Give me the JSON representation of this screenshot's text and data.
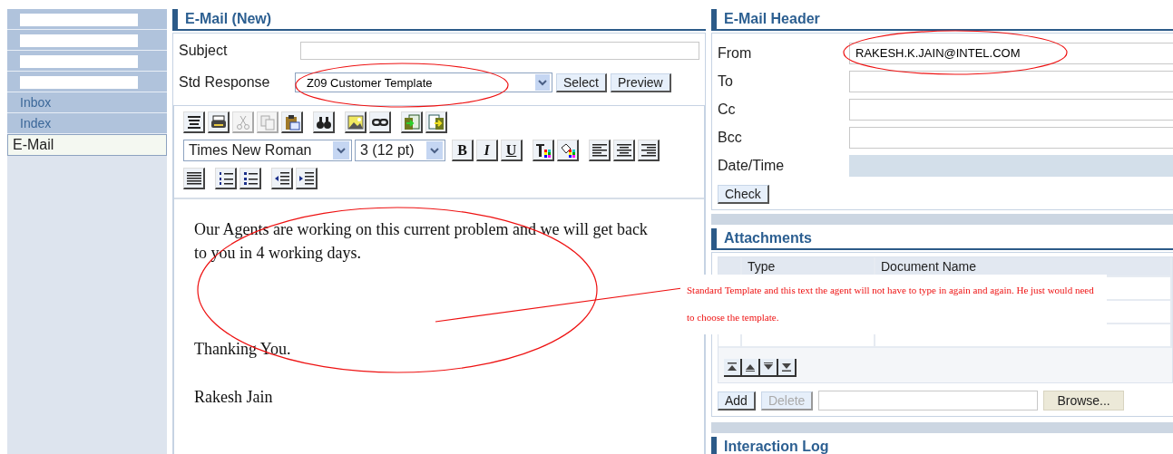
{
  "sidebar": {
    "items": [
      {
        "kind": "redacted",
        "selected": false
      },
      {
        "kind": "redacted",
        "selected": false
      },
      {
        "kind": "redacted",
        "selected": false
      },
      {
        "kind": "redacted",
        "selected": false
      },
      {
        "kind": "link",
        "label": "Inbox",
        "selected": false
      },
      {
        "kind": "link",
        "label": "Index",
        "selected": false
      },
      {
        "kind": "link",
        "label": "E-Mail",
        "selected": true
      }
    ]
  },
  "email": {
    "title": "E-Mail (New)",
    "subject": {
      "label": "Subject"
    },
    "std_response": {
      "label": "Std Response",
      "value": "Z09 Customer Template"
    },
    "buttons": [
      "Select",
      "Preview"
    ],
    "tools": [
      {
        "kind": "html",
        "disabled": false
      },
      {
        "kind": "print",
        "disabled": false
      },
      {
        "kind": "cut",
        "disabled": true
      },
      {
        "kind": "copy",
        "disabled": true
      },
      {
        "kind": "paste",
        "disabled": false
      },
      {
        "kind": "find",
        "disabled": false
      },
      {
        "kind": "image",
        "disabled": false
      },
      {
        "kind": "link",
        "disabled": false
      },
      {
        "kind": "import",
        "disabled": false
      },
      {
        "kind": "export",
        "disabled": false
      }
    ],
    "font": "Times New Roman",
    "size": "3 (12 pt)",
    "format_buttons": [
      "B",
      "I",
      "U"
    ],
    "color_tools": [
      {
        "kind": "text-color"
      },
      {
        "kind": "fill-color"
      }
    ],
    "align_tools": [
      {
        "kind": "left"
      },
      {
        "kind": "center"
      },
      {
        "kind": "right"
      }
    ],
    "list_tools": [
      {
        "kind": "justify"
      },
      {
        "kind": "numbered"
      },
      {
        "kind": "bullets"
      },
      {
        "kind": "outdent"
      },
      {
        "kind": "indent"
      }
    ],
    "body": [
      "Our Agents are working on this current problem and we will get back to you in 4 working days.",
      "Thanking You.",
      "Rakesh Jain"
    ]
  },
  "header": {
    "title": "E-Mail Header",
    "fields": [
      {
        "label": "From",
        "kind": "text",
        "value": "RAKESH.K.JAIN@INTEL.COM"
      },
      {
        "label": "To",
        "kind": "text"
      },
      {
        "label": "Cc",
        "kind": "text"
      },
      {
        "label": "Bcc",
        "kind": "text"
      },
      {
        "label": "Date/Time",
        "kind": "readonly"
      }
    ],
    "button": "Check"
  },
  "attachments": {
    "title": "Attachments",
    "columns": [
      "Type",
      "Document Name"
    ],
    "buttons": [
      {
        "label": "Add",
        "disabled": false
      },
      {
        "label": "Delete",
        "disabled": true
      }
    ],
    "browse": "Browse..."
  },
  "interaction_log": {
    "title": "Interaction Log"
  },
  "annotation": {
    "text": "Standard Template and this text the agent will not have to type in again and again. He just would need to choose the template."
  }
}
